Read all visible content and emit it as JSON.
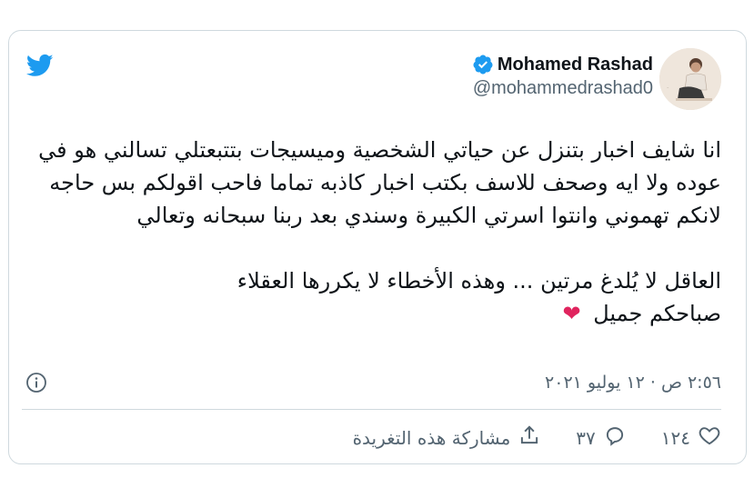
{
  "user": {
    "display_name": "Mohamed Rashad",
    "handle": "@mohammedrashad0",
    "verified": true
  },
  "tweet": {
    "paragraph1": "انا شايف اخبار بتنزل عن حياتي الشخصية وميسيجات بتتبعتلي تسالني هو في عوده ولا ايه وصحف للاسف بكتب اخبار كاذبه تماما فاحب اقولكم بس حاجه لانكم تهموني وانتوا اسرتي الكبيرة وسندي بعد ربنا سبحانه وتعالي",
    "paragraph2_line1": "العاقل لا يُلدغ مرتين ... وهذه الأخطاء لا يكررها العقلاء",
    "paragraph2_line2": "صباحكم جميل",
    "emoji": "❤"
  },
  "timestamp": "٢:٥٦ ص · ١٢ يوليو ٢٠٢١",
  "actions": {
    "likes": "١٢٤",
    "replies": "٣٧",
    "share_label": "مشاركة هذه التغريدة"
  },
  "colors": {
    "twitter_blue": "#1d9bf0",
    "text_secondary": "#536471",
    "border": "#cfd9de",
    "heart": "#e0245e"
  },
  "icons": [
    "twitter-logo-icon",
    "verified-badge-icon",
    "info-icon",
    "heart-icon",
    "reply-icon",
    "share-icon"
  ]
}
